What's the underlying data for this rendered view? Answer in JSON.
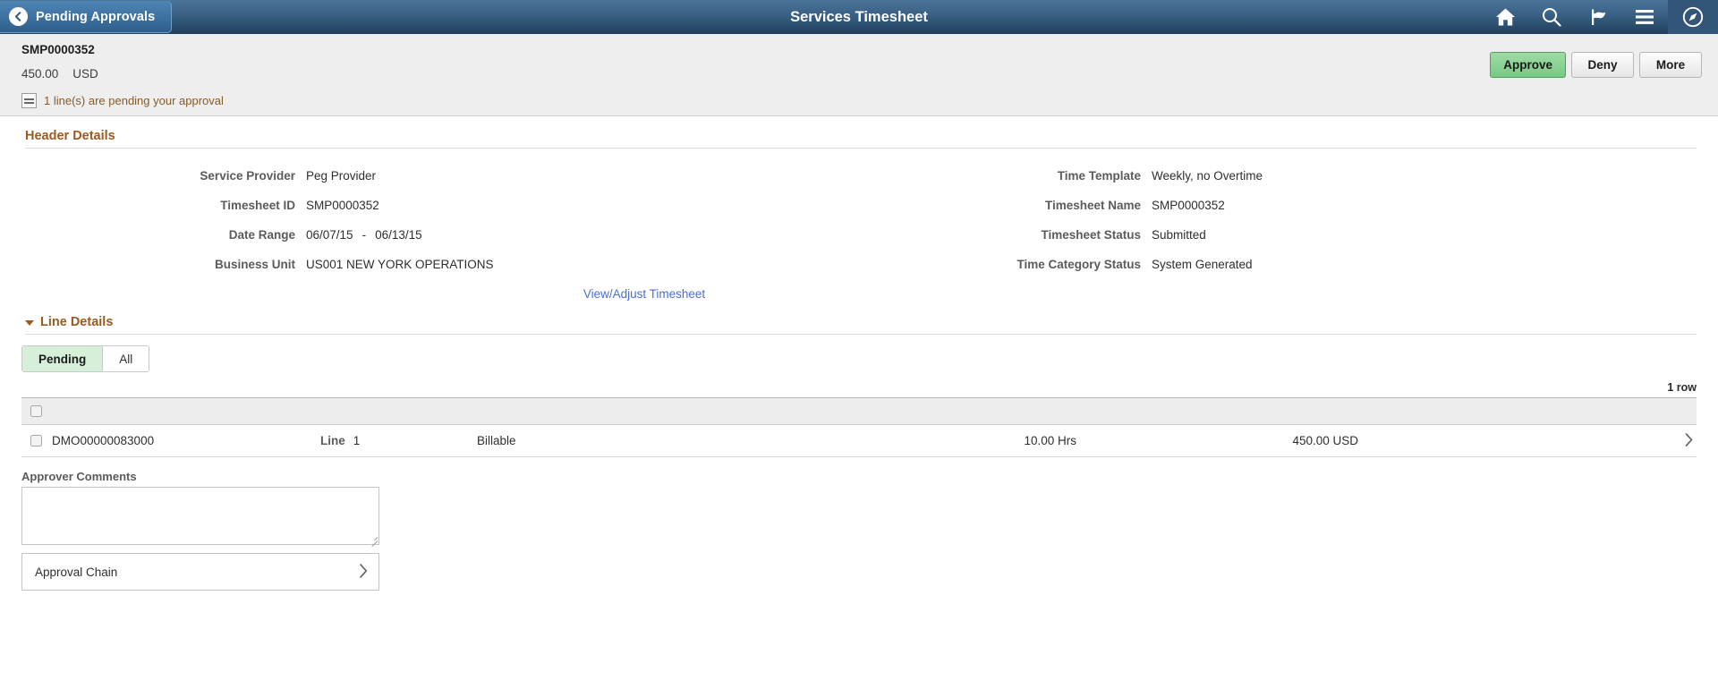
{
  "topbar": {
    "back_label": "Pending Approvals",
    "title": "Services Timesheet",
    "icons": [
      "home-icon",
      "search-icon",
      "flag-icon",
      "hamburger-menu-icon",
      "navbar-compass-icon"
    ]
  },
  "subheader": {
    "timesheet_id": "SMP0000352",
    "amount": "450.00",
    "currency": "USD",
    "pending_note": "1 line(s) are pending your approval",
    "buttons": {
      "approve": "Approve",
      "deny": "Deny",
      "more": "More"
    }
  },
  "header_details": {
    "title": "Header Details",
    "left": [
      {
        "label": "Service Provider",
        "value": "Peg Provider"
      },
      {
        "label": "Timesheet ID",
        "value": "SMP0000352"
      },
      {
        "label": "Date Range",
        "value": "06/07/15",
        "value2": "06/13/15",
        "separator": "-"
      },
      {
        "label": "Business Unit",
        "value": "US001 NEW YORK OPERATIONS"
      }
    ],
    "right": [
      {
        "label": "Time Template",
        "value": "Weekly, no Overtime"
      },
      {
        "label": "Timesheet Name",
        "value": "SMP0000352"
      },
      {
        "label": "Timesheet Status",
        "value": "Submitted"
      },
      {
        "label": "Time Category Status",
        "value": "System Generated"
      }
    ],
    "link": "View/Adjust Timesheet"
  },
  "line_details": {
    "title": "Line Details",
    "tabs": [
      {
        "label": "Pending",
        "active": true
      },
      {
        "label": "All",
        "active": false
      }
    ],
    "row_count": "1 row",
    "rows": [
      {
        "description": "DMO00000083000",
        "line_label": "Line",
        "line_number": "1",
        "type": "Billable",
        "hours": "10.00 Hrs",
        "amount": "450.00 USD"
      }
    ]
  },
  "approver_comments": {
    "label": "Approver Comments",
    "value": "",
    "placeholder": ""
  },
  "approval_chain": {
    "label": "Approval Chain"
  },
  "colors": {
    "accent_brown": "#9c5a1e",
    "link_blue": "#4a6dd8",
    "approve_green": "#79c984",
    "tab_active_green": "#d6efd9",
    "navbar_blue": "#2b4e6d"
  }
}
